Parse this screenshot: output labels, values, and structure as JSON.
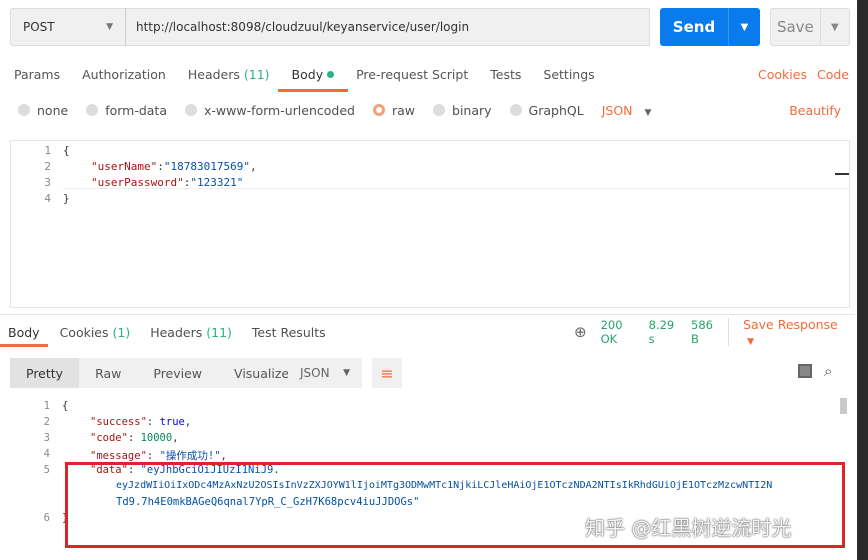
{
  "request": {
    "method": "POST",
    "url": "http://localhost:8098/cloudzuul/keyanservice/user/login",
    "send_label": "Send",
    "save_label": "Save"
  },
  "tabs": [
    {
      "label": "Params"
    },
    {
      "label": "Authorization"
    },
    {
      "label": "Headers",
      "count": "(11)"
    },
    {
      "label": "Body"
    },
    {
      "label": "Pre-request Script"
    },
    {
      "label": "Tests"
    },
    {
      "label": "Settings"
    }
  ],
  "links": {
    "cookies": "Cookies",
    "code": "Code",
    "beautify": "Beautify"
  },
  "body_types": [
    {
      "label": "none"
    },
    {
      "label": "form-data"
    },
    {
      "label": "x-www-form-urlencoded"
    },
    {
      "label": "raw",
      "selected": true
    },
    {
      "label": "binary"
    },
    {
      "label": "GraphQL"
    }
  ],
  "raw_format": "JSON",
  "request_body": {
    "lines": [
      "1",
      "2",
      "3",
      "4"
    ],
    "open": "{",
    "k1": "\"userName\"",
    "v1": "\"18783017569\"",
    "k2": "\"userPassword\"",
    "v2": "\"123321\"",
    "close": "}"
  },
  "response_tabs": [
    {
      "label": "Body"
    },
    {
      "label": "Cookies",
      "count": "(1)"
    },
    {
      "label": "Headers",
      "count": "(11)"
    },
    {
      "label": "Test Results"
    }
  ],
  "status": {
    "code": "200 OK",
    "time": "8.29 s",
    "size": "586 B",
    "save_response": "Save Response"
  },
  "view_modes": [
    "Pretty",
    "Raw",
    "Preview",
    "Visualize"
  ],
  "response_format": "JSON",
  "response_body": {
    "lines": [
      "1",
      "2",
      "3",
      "4",
      "5",
      "6"
    ],
    "open": "{",
    "success_key": "\"success\"",
    "success_val": "true",
    "code_key": "\"code\"",
    "code_val": "10000",
    "message_key": "\"message\"",
    "message_val": "\"操作成功!\"",
    "data_key": "\"data\"",
    "data_val1": "\"eyJhbGciOiJIUzI1NiJ9.",
    "data_val2": "eyJzdWIiOiIxODc4MzAxNzU2OSIsInVzZXJOYW1lIjoiMTg3ODMwMTc1NjkiLCJleHAiOjE1OTczNDA2NTIsIkRhdGUiOjE1OTczMzcwNTI2N",
    "data_val3": "Td9.7h4E0mkBAGeQ6qnal7YpR_C_GzH7K68pcv4iuJJDOGs\"",
    "close": "}"
  },
  "watermark": "知乎 @红黑树逆流时光"
}
